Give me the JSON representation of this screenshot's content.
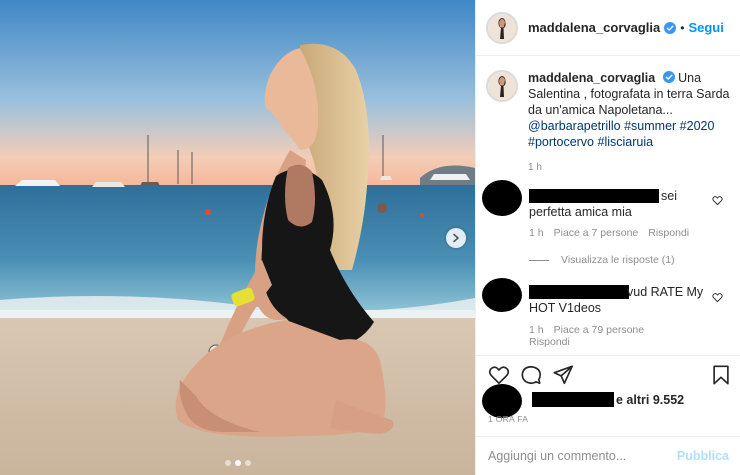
{
  "post": {
    "username": "maddalena_corvaglia",
    "follow_label": "Segui",
    "separator": "•",
    "caption_text": "Una Salentina , fotografata in terra Sarda da un'amica Napoletana...",
    "caption_links": [
      "@barbarapetrillo",
      "#summer",
      "#2020",
      "#portocervo",
      "#lisciaruia"
    ],
    "caption_time": "1 h",
    "post_time": "1 ORA FA"
  },
  "comments": [
    {
      "text_visible": "sei perfetta amica mia",
      "time": "1 h",
      "likes": "Piace a 7 persone",
      "reply_label": "Rispondi",
      "view_replies": "Visualizza le risposte (1)"
    },
    {
      "text_visible": "vud RATE My HOT V1deos",
      "time": "1 h",
      "likes": "Piace a 79 persone",
      "reply_label": "Rispondi"
    }
  ],
  "likes": {
    "text": "e altri 9.552"
  },
  "comment_box": {
    "placeholder": "Aggiungi un commento...",
    "publish_label": "Pubblica"
  },
  "icons": {
    "verified": "verified-badge-icon",
    "heart": "heart-icon",
    "comment": "comment-icon",
    "share": "share-icon",
    "save": "bookmark-icon",
    "next": "chevron-right-icon"
  },
  "colors": {
    "link": "#00376b",
    "follow": "#0095f6",
    "publish_disabled": "#b2dffc",
    "muted": "#8e8e8e",
    "verified": "#3897f0"
  }
}
